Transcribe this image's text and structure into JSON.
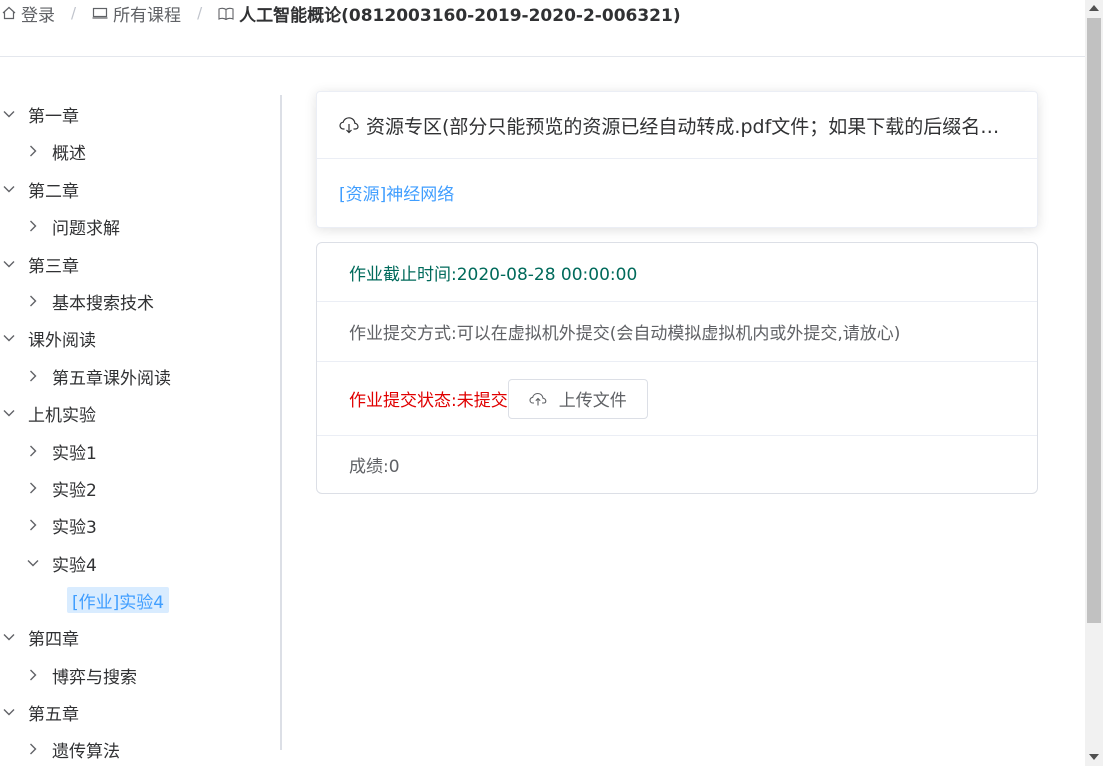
{
  "breadcrumb": {
    "login": "登录",
    "all_courses": "所有课程",
    "course": "人工智能概论(0812003160-2019-2020-2-006321)"
  },
  "tree": {
    "ch1": "第一章",
    "ch1_overview": "概述",
    "ch2": "第二章",
    "ch2_problem": "问题求解",
    "ch3": "第三章",
    "ch3_search": "基本搜索技术",
    "extra": "课外阅读",
    "extra_ch5": "第五章课外阅读",
    "lab": "上机实验",
    "lab1": "实验1",
    "lab2": "实验2",
    "lab3": "实验3",
    "lab4": "实验4",
    "lab4_hw": "[作业]实验4",
    "ch4": "第四章",
    "ch4_game": "博弈与搜索",
    "ch5": "第五章",
    "ch5_ga": "遗传算法"
  },
  "resources": {
    "title": "资源专区(部分只能预览的资源已经自动转成.pdf文件；如果下载的后缀名不正确请自行修改)",
    "link": "[资源]神经网络"
  },
  "assignment": {
    "deadline": "作业截止时间:2020-08-28 00:00:00",
    "method": "作业提交方式:可以在虚拟机外提交(会自动模拟虚拟机内或外提交,请放心)",
    "status": "作业提交状态:未提交",
    "upload_label": "上传文件",
    "score": "成绩:0"
  },
  "colors": {
    "link": "#409eff",
    "deadline": "#006a5b",
    "status": "#e00000",
    "selected_bg": "#d9ecff"
  }
}
